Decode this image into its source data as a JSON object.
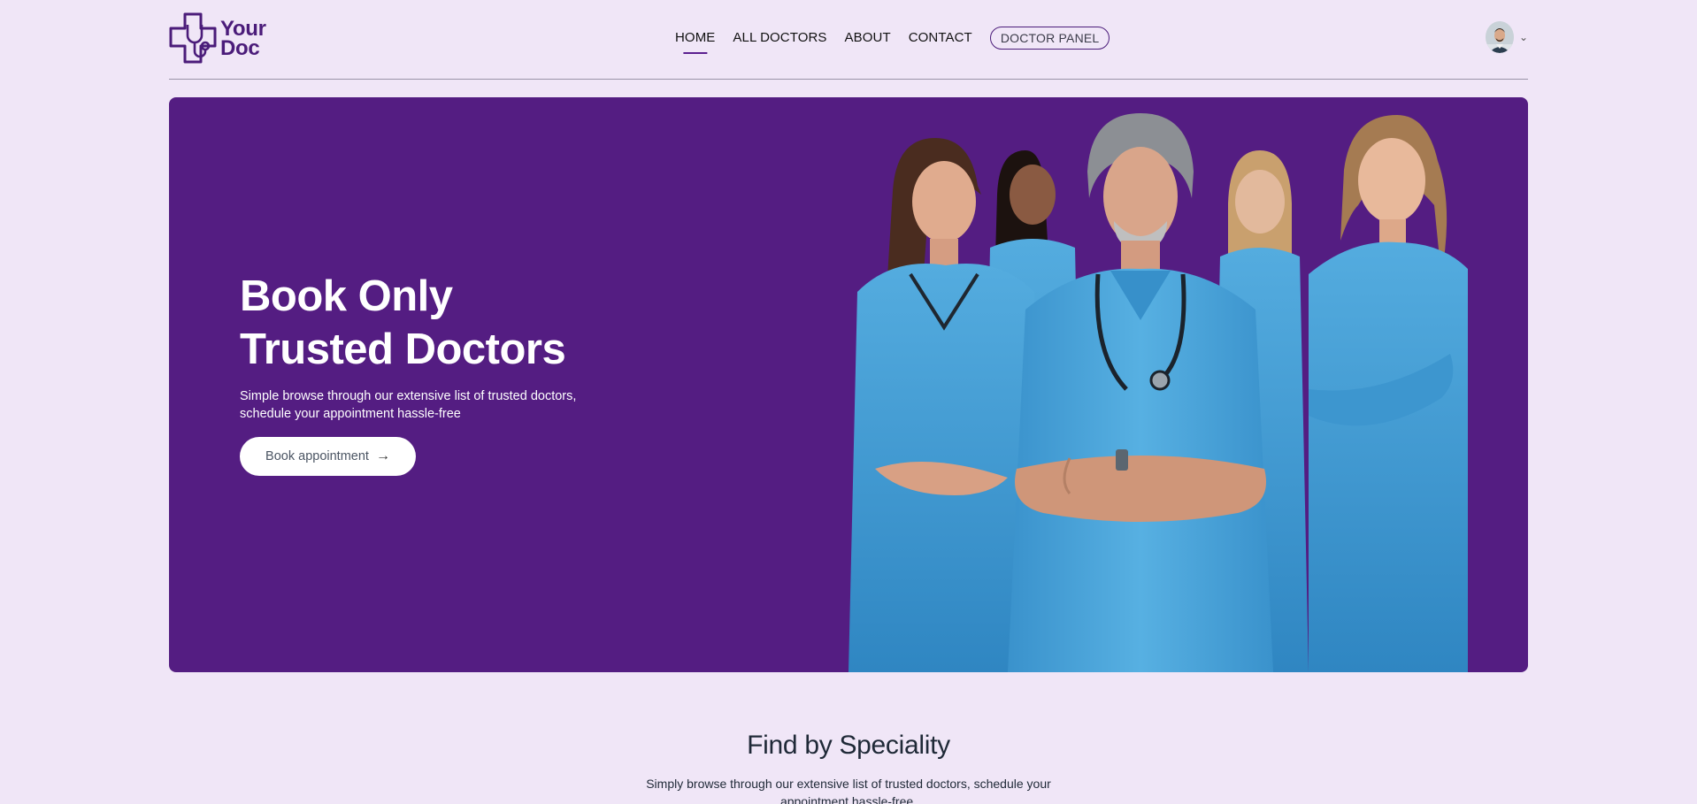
{
  "brand": {
    "line1": "Your",
    "line2": "Doc",
    "color": "#4b1c7a"
  },
  "nav": {
    "items": [
      {
        "label": "HOME",
        "active": true
      },
      {
        "label": "ALL DOCTORS",
        "active": false
      },
      {
        "label": "ABOUT",
        "active": false
      },
      {
        "label": "CONTACT",
        "active": false
      }
    ],
    "panel_button": "DOCTOR PANEL"
  },
  "profile": {
    "avatar_icon": "user-avatar",
    "dropdown_icon": "chevron-down-icon"
  },
  "hero": {
    "title_line1": "Book Only",
    "title_line2": "Trusted Doctors",
    "subtitle_line1": "Simple browse through our extensive list of trusted doctors,",
    "subtitle_line2": "schedule your appointment hassle-free",
    "button_label": "Book appointment",
    "button_icon": "arrow-right-icon",
    "background_color": "#541d82",
    "image": "group-of-doctors-in-blue-scrubs"
  },
  "speciality": {
    "title": "Find by Speciality",
    "subtitle_line1": "Simply browse through our extensive list of trusted doctors, schedule your",
    "subtitle_line2": "appointment hassle-free."
  },
  "colors": {
    "page_bg": "#f0e6f7",
    "accent": "#541d82",
    "scrubs": "#3d9ad4"
  }
}
